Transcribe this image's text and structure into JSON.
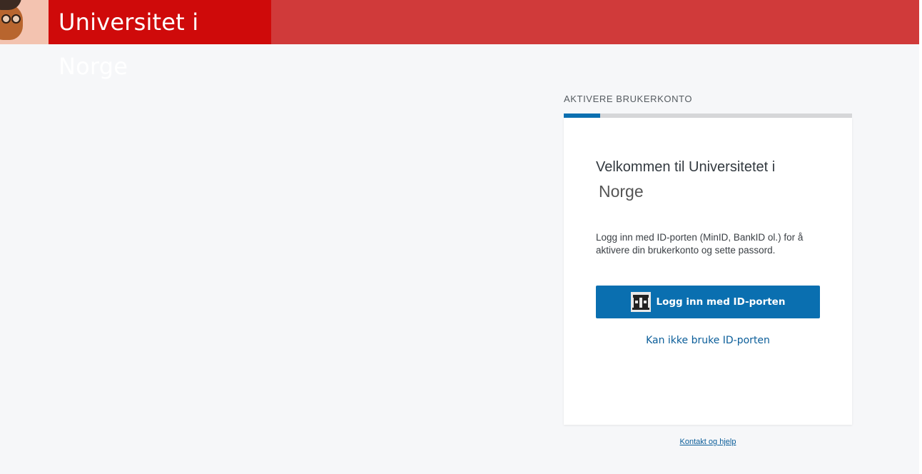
{
  "header": {
    "logo_text": "Universitet i Norge",
    "bg_color": "#d03a3a",
    "logo_bg_color": "#cf0a0a"
  },
  "page": {
    "section_label": "AKTIVERE BRUKERKONTO",
    "progress": 0.125
  },
  "card": {
    "welcome_line1": "Velkommen til Universitetet i",
    "welcome_line2": "Norge",
    "description": "Logg inn med ID-porten (MinID, BankID ol.) for å aktivere din brukerkonto og sette passord.",
    "login_button_label": "Logg inn med ID-porten",
    "login_button_icon": "id-porten-icon",
    "alt_link": "Kan ikke bruke ID-porten"
  },
  "footer": {
    "help_link": "Kontakt og hjelp"
  },
  "colors": {
    "accent": "#0a6fb0",
    "link": "#0a5d99"
  }
}
